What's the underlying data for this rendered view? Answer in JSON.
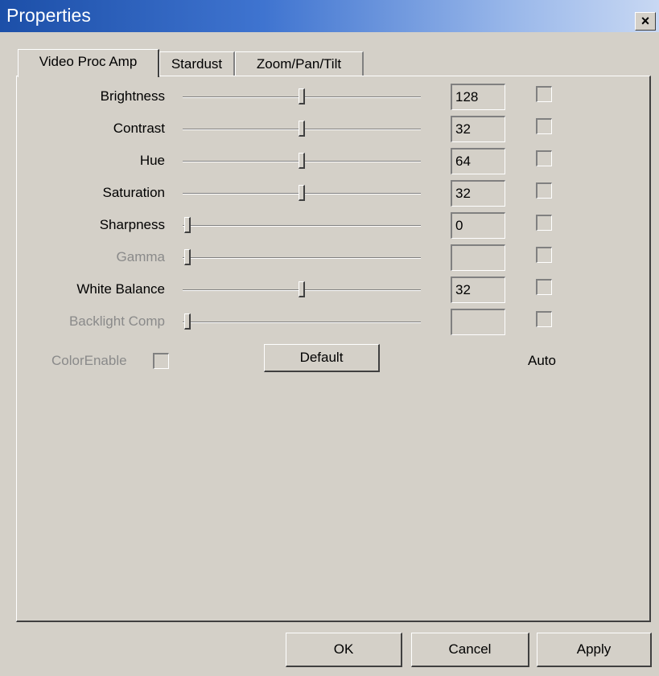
{
  "window": {
    "title": "Properties",
    "close_glyph": "×"
  },
  "tabs": [
    {
      "label": "Video Proc Amp",
      "active": true
    },
    {
      "label": "Stardust",
      "active": false
    },
    {
      "label": "Zoom/Pan/Tilt",
      "active": false
    }
  ],
  "controls": [
    {
      "label": "Brightness",
      "value": "128",
      "level": 0.5,
      "enabled": true,
      "auto": false
    },
    {
      "label": "Contrast",
      "value": "32",
      "level": 0.5,
      "enabled": true,
      "auto": false
    },
    {
      "label": "Hue",
      "value": "64",
      "level": 0.5,
      "enabled": true,
      "auto": false
    },
    {
      "label": "Saturation",
      "value": "32",
      "level": 0.5,
      "enabled": true,
      "auto": false
    },
    {
      "label": "Sharpness",
      "value": "0",
      "level": 0.0,
      "enabled": true,
      "auto": false
    },
    {
      "label": "Gamma",
      "value": "",
      "level": 0.0,
      "enabled": false,
      "auto": false
    },
    {
      "label": "White Balance",
      "value": "32",
      "level": 0.5,
      "enabled": true,
      "auto": false
    },
    {
      "label": "Backlight Comp",
      "value": "",
      "level": 0.0,
      "enabled": false,
      "auto": false
    }
  ],
  "color_enable": {
    "label": "ColorEnable",
    "checked": false,
    "enabled": false
  },
  "default_button": {
    "label": "Default"
  },
  "auto_column": {
    "label": "Auto"
  },
  "footer": {
    "ok_label": "OK",
    "cancel_label": "Cancel",
    "apply_label": "Apply"
  },
  "colors": {
    "face": "#d4d0c8",
    "title_start": "#1c4fa8",
    "title_end": "#c8d8f3",
    "disabled_text": "#8a8a8a"
  }
}
